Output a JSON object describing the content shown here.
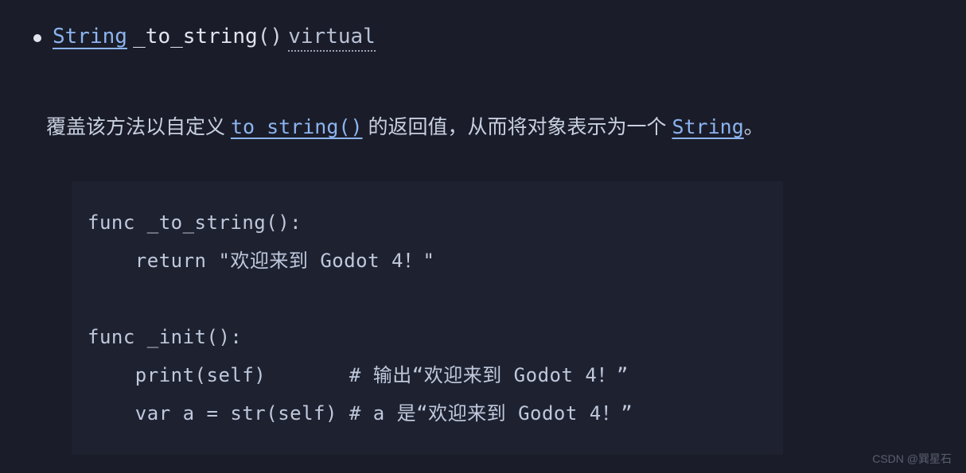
{
  "signature": {
    "return_type": "String",
    "method_name": "_to_string",
    "parens": "()",
    "qualifier": "virtual"
  },
  "description": {
    "prefix": "覆盖该方法以自定义 ",
    "link1": "to_string()",
    "mid": " 的返回值，从而将对象表示为一个 ",
    "link2": "String",
    "suffix": "。"
  },
  "code": "func _to_string():\n    return \"欢迎来到 Godot 4！\"\n\nfunc _init():\n    print(self)       # 输出“欢迎来到 Godot 4！”\n    var a = str(self) # a 是“欢迎来到 Godot 4！”",
  "watermark": "CSDN @巽星石"
}
